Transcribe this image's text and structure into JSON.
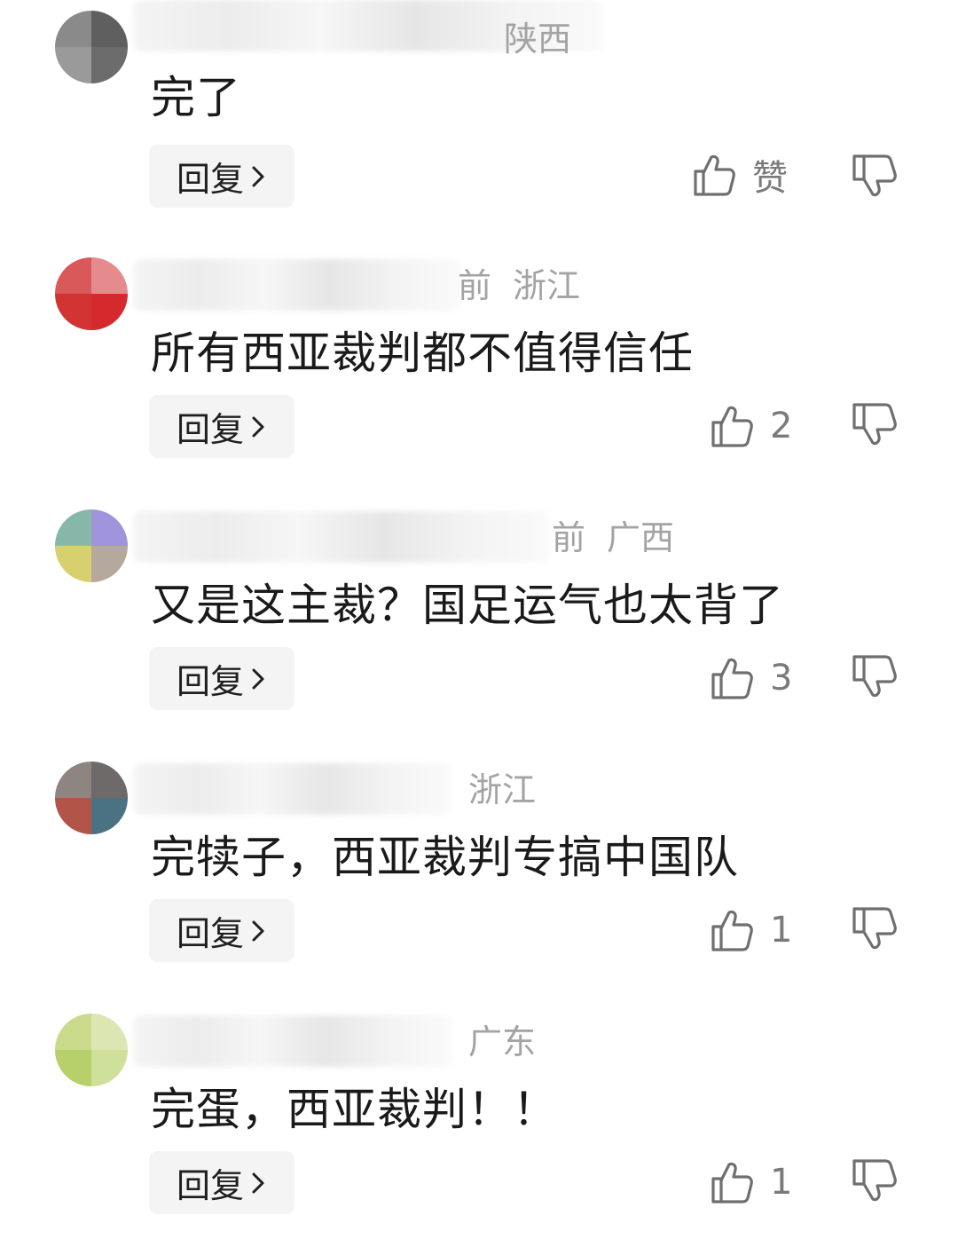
{
  "comments": [
    {
      "region": "陕西",
      "meta_partial": "",
      "text": "完了",
      "reply_label": "回复",
      "like_label": "赞",
      "avatar_colors": [
        "#8a8a8a",
        "#5f5f5f",
        "#9a9a9a",
        "#6c6c6c"
      ]
    },
    {
      "region": "浙江",
      "meta_partial": "前",
      "text": "所有西亚裁判都不值得信任",
      "reply_label": "回复",
      "like_label": "2",
      "avatar_colors": [
        "#d9595a",
        "#e58b8d",
        "#d23333",
        "#d42a2e"
      ]
    },
    {
      "region": "广西",
      "meta_partial": "前",
      "text": "又是这主裁？国足运气也太背了",
      "reply_label": "回复",
      "like_label": "3",
      "avatar_colors": [
        "#86b7a9",
        "#9f93dc",
        "#d8cf6f",
        "#b4a99c"
      ]
    },
    {
      "region": "浙江",
      "meta_partial": "",
      "text": "完犊子，西亚裁判专搞中国队",
      "reply_label": "回复",
      "like_label": "1",
      "avatar_colors": [
        "#8e8480",
        "#6d6a69",
        "#b25548",
        "#4b7283"
      ]
    },
    {
      "region": "广东",
      "meta_partial": "",
      "text": "完蛋，西亚裁判！！",
      "reply_label": "回复",
      "like_label": "1",
      "avatar_colors": [
        "#c9da8a",
        "#dbe6b3",
        "#b8d06b",
        "#cfe09a"
      ]
    }
  ],
  "colors": {
    "text": "#1a1a1a",
    "meta": "#a3a3a3",
    "count": "#7a7a7a",
    "reply_bg": "#f4f4f4",
    "icon": "#6f6f6f"
  }
}
